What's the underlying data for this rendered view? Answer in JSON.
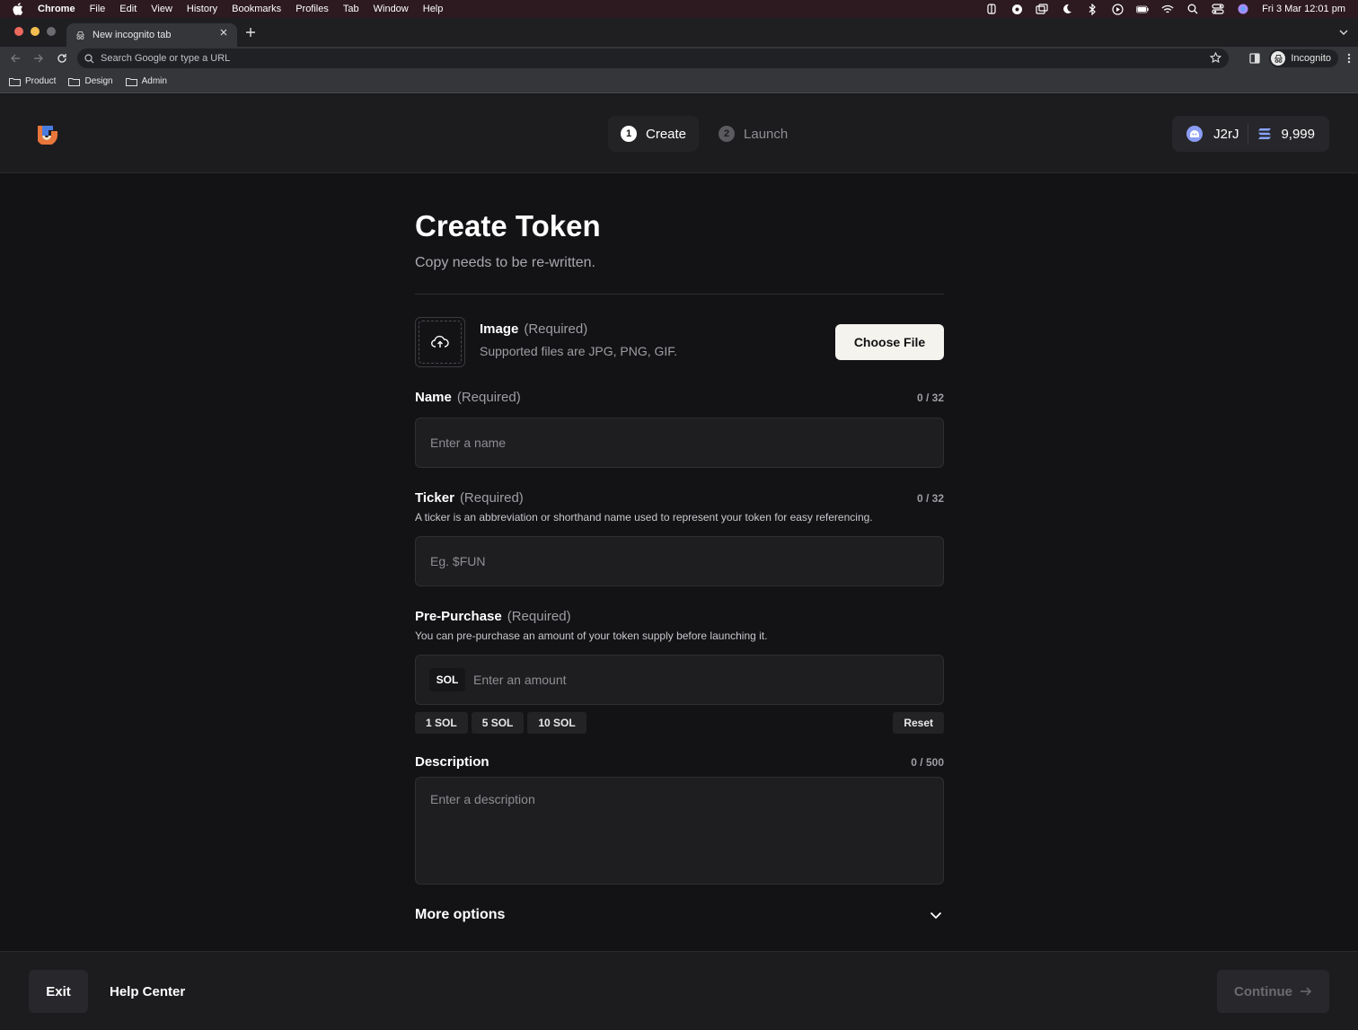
{
  "menubar": {
    "items": [
      "Chrome",
      "File",
      "Edit",
      "View",
      "History",
      "Bookmarks",
      "Profiles",
      "Tab",
      "Window",
      "Help"
    ],
    "datetime": "Fri 3 Mar  12:01 pm"
  },
  "browser": {
    "tab_title": "New incognito tab",
    "omnibox_placeholder": "Search Google or type a URL",
    "profile_label": "Incognito",
    "bookmarks": [
      "Product",
      "Design",
      "Admin"
    ]
  },
  "header": {
    "steps": [
      {
        "number": "1",
        "label": "Create"
      },
      {
        "number": "2",
        "label": "Launch"
      }
    ],
    "wallet": {
      "address": "J2rJ",
      "balance": "9,999"
    }
  },
  "form": {
    "title": "Create Token",
    "subtitle": "Copy needs to be re-written.",
    "required_tag": "(Required)",
    "image": {
      "label": "Image",
      "hint": "Supported files are JPG, PNG, GIF.",
      "button": "Choose File"
    },
    "name": {
      "label": "Name",
      "counter": "0 / 32",
      "placeholder": "Enter a name"
    },
    "ticker": {
      "label": "Ticker",
      "counter": "0 / 32",
      "hint": "A ticker is an abbreviation or shorthand name used to represent your token for easy referencing.",
      "placeholder": "Eg. $FUN"
    },
    "prepurchase": {
      "label": "Pre-Purchase",
      "hint": "You can pre-purchase an amount of your token supply before launching it.",
      "currency": "SOL",
      "placeholder": "Enter an amount",
      "quick": [
        "1 SOL",
        "5 SOL",
        "10 SOL"
      ],
      "reset": "Reset"
    },
    "description": {
      "label": "Description",
      "counter": "0 / 500",
      "placeholder": "Enter a description"
    },
    "more_options": "More options"
  },
  "footer": {
    "exit": "Exit",
    "help": "Help Center",
    "continue": "Continue"
  }
}
